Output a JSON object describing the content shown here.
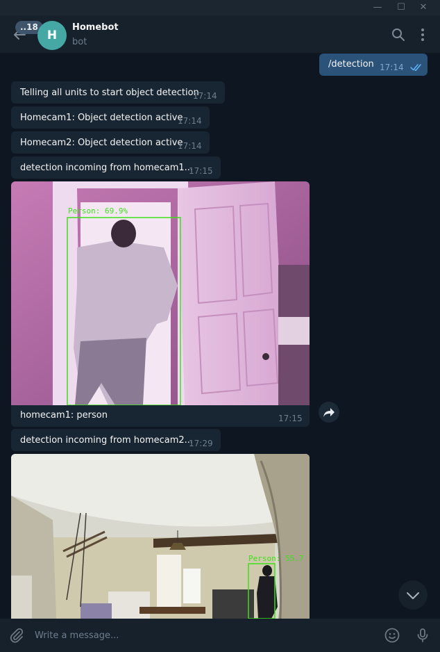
{
  "window": {
    "minimize_glyph": "—",
    "maximize_glyph": "☐",
    "close_glyph": "✕"
  },
  "header": {
    "unread_badge": "..18",
    "avatar_letter": "H",
    "title": "Homebot",
    "subtitle": "bot"
  },
  "messages": [
    {
      "id": "m1",
      "direction": "out",
      "text": "/detection",
      "time": "17:14",
      "status": "read"
    },
    {
      "id": "m2",
      "direction": "in",
      "text": "Telling all units to start object detection",
      "time": "17:14"
    },
    {
      "id": "m3",
      "direction": "in",
      "text": "Homecam1: Object detection active",
      "time": "17:14"
    },
    {
      "id": "m4",
      "direction": "in",
      "text": "Homecam2: Object detection active",
      "time": "17:14"
    },
    {
      "id": "m5",
      "direction": "in",
      "text": "detection incoming from homecam1...",
      "time": "17:15"
    },
    {
      "id": "m6",
      "direction": "in",
      "type": "photo",
      "overlay_label": "Person: 69.9%",
      "caption": "homecam1: person",
      "time": "17:15"
    },
    {
      "id": "m7",
      "direction": "in",
      "text": "detection incoming from homecam2...",
      "time": "17:29"
    },
    {
      "id": "m8",
      "direction": "in",
      "type": "photo",
      "overlay_label": "Person: 55.7"
    }
  ],
  "input": {
    "placeholder": "Write a message..."
  },
  "icons": {
    "back": "arrow-left-icon",
    "search": "search-icon",
    "more": "more-vertical-icon",
    "forward": "share-arrow-icon",
    "scroll_down": "chevron-down-icon",
    "attach": "paperclip-icon",
    "emoji": "smiley-icon",
    "mic": "microphone-icon"
  },
  "colors": {
    "background": "#0e1621",
    "header": "#17212b",
    "incoming_bubble": "#182533",
    "outgoing_bubble": "#2b5278",
    "accent": "#5eb5f7",
    "detection_box": "#3ee01a"
  }
}
